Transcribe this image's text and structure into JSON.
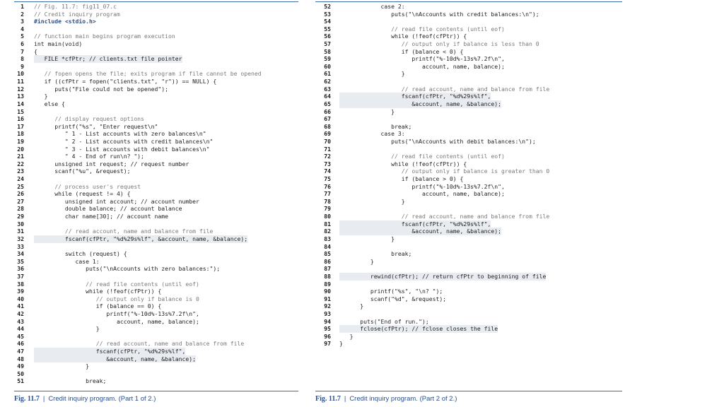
{
  "left": {
    "caption": {
      "fig": "Fig. 11.7",
      "sep": "|",
      "text": "Credit inquiry program. (Part 1 of 2.)"
    },
    "lines": [
      {
        "n": "1",
        "t": "// Fig. 11.7: fig11_07.c",
        "k": "cm"
      },
      {
        "n": "2",
        "t": "// Credit inquiry program",
        "k": "cm"
      },
      {
        "n": "3",
        "t": "#include <stdio.h>",
        "k": "kw"
      },
      {
        "n": "4",
        "t": "",
        "k": ""
      },
      {
        "n": "5",
        "t": "// function main begins program execution",
        "k": "cm"
      },
      {
        "n": "6",
        "t": "int main(void)",
        "k": ""
      },
      {
        "n": "7",
        "t": "{",
        "k": ""
      },
      {
        "n": "8",
        "t": "   FILE *cfPtr; // clients.txt file pointer",
        "k": "hl"
      },
      {
        "n": "9",
        "t": "",
        "k": ""
      },
      {
        "n": "10",
        "t": "   // fopen opens the file; exits program if file cannot be opened",
        "k": "cm"
      },
      {
        "n": "11",
        "t": "   if ((cfPtr = fopen(\"clients.txt\", \"r\")) == NULL) {",
        "k": ""
      },
      {
        "n": "12",
        "t": "      puts(\"File could not be opened\");",
        "k": ""
      },
      {
        "n": "13",
        "t": "   }",
        "k": ""
      },
      {
        "n": "14",
        "t": "   else {",
        "k": ""
      },
      {
        "n": "15",
        "t": "",
        "k": ""
      },
      {
        "n": "16",
        "t": "      // display request options",
        "k": "cm"
      },
      {
        "n": "17",
        "t": "      printf(\"%s\", \"Enter request\\n\"",
        "k": ""
      },
      {
        "n": "18",
        "t": "         \" 1 - List accounts with zero balances\\n\"",
        "k": ""
      },
      {
        "n": "19",
        "t": "         \" 2 - List accounts with credit balances\\n\"",
        "k": ""
      },
      {
        "n": "20",
        "t": "         \" 3 - List accounts with debit balances\\n\"",
        "k": ""
      },
      {
        "n": "21",
        "t": "         \" 4 - End of run\\n? \");",
        "k": ""
      },
      {
        "n": "22",
        "t": "      unsigned int request; // request number",
        "k": ""
      },
      {
        "n": "23",
        "t": "      scanf(\"%u\", &request);",
        "k": ""
      },
      {
        "n": "24",
        "t": "",
        "k": ""
      },
      {
        "n": "25",
        "t": "      // process user's request",
        "k": "cm"
      },
      {
        "n": "26",
        "t": "      while (request != 4) {",
        "k": ""
      },
      {
        "n": "27",
        "t": "         unsigned int account; // account number",
        "k": ""
      },
      {
        "n": "28",
        "t": "         double balance; // account balance",
        "k": ""
      },
      {
        "n": "29",
        "t": "         char name[30]; // account name",
        "k": ""
      },
      {
        "n": "30",
        "t": "",
        "k": ""
      },
      {
        "n": "31",
        "t": "         // read account, name and balance from file",
        "k": "cm"
      },
      {
        "n": "32",
        "t": "         fscanf(cfPtr, \"%d%29s%lf\", &account, name, &balance);",
        "k": "hl"
      },
      {
        "n": "33",
        "t": "",
        "k": ""
      },
      {
        "n": "34",
        "t": "         switch (request) {",
        "k": ""
      },
      {
        "n": "35",
        "t": "            case 1:",
        "k": ""
      },
      {
        "n": "36",
        "t": "               puts(\"\\nAccounts with zero balances:\");",
        "k": ""
      },
      {
        "n": "37",
        "t": "",
        "k": ""
      },
      {
        "n": "38",
        "t": "               // read file contents (until eof)",
        "k": "cm"
      },
      {
        "n": "39",
        "t": "               while (!feof(cfPtr)) {",
        "k": ""
      },
      {
        "n": "40",
        "t": "                  // output only if balance is 0",
        "k": "cm"
      },
      {
        "n": "41",
        "t": "                  if (balance == 0) {",
        "k": ""
      },
      {
        "n": "42",
        "t": "                     printf(\"%-10d%-13s%7.2f\\n\",",
        "k": ""
      },
      {
        "n": "43",
        "t": "                        account, name, balance);",
        "k": ""
      },
      {
        "n": "44",
        "t": "                  }",
        "k": ""
      },
      {
        "n": "45",
        "t": "",
        "k": ""
      },
      {
        "n": "46",
        "t": "                  // read account, name and balance from file",
        "k": "cm"
      },
      {
        "n": "47",
        "t": "                  fscanf(cfPtr, \"%d%29s%lf\",",
        "k": "hl"
      },
      {
        "n": "48",
        "t": "                     &account, name, &balance);",
        "k": "hl"
      },
      {
        "n": "49",
        "t": "               }",
        "k": ""
      },
      {
        "n": "50",
        "t": "",
        "k": ""
      },
      {
        "n": "51",
        "t": "               break;",
        "k": ""
      }
    ]
  },
  "right": {
    "caption": {
      "fig": "Fig. 11.7",
      "sep": "|",
      "text": "Credit inquiry program. (Part 2 of 2.)"
    },
    "lines": [
      {
        "n": "52",
        "t": "            case 2:",
        "k": ""
      },
      {
        "n": "53",
        "t": "               puts(\"\\nAccounts with credit balances:\\n\");",
        "k": ""
      },
      {
        "n": "54",
        "t": "",
        "k": ""
      },
      {
        "n": "55",
        "t": "               // read file contents (until eof)",
        "k": "cm"
      },
      {
        "n": "56",
        "t": "               while (!feof(cfPtr)) {",
        "k": ""
      },
      {
        "n": "57",
        "t": "                  // output only if balance is less than 0",
        "k": "cm"
      },
      {
        "n": "58",
        "t": "                  if (balance < 0) {",
        "k": ""
      },
      {
        "n": "59",
        "t": "                     printf(\"%-10d%-13s%7.2f\\n\",",
        "k": ""
      },
      {
        "n": "60",
        "t": "                        account, name, balance);",
        "k": ""
      },
      {
        "n": "61",
        "t": "                  }",
        "k": ""
      },
      {
        "n": "62",
        "t": "",
        "k": ""
      },
      {
        "n": "63",
        "t": "                  // read account, name and balance from file",
        "k": "cm"
      },
      {
        "n": "64",
        "t": "                  fscanf(cfPtr, \"%d%29s%lf\",",
        "k": "hl"
      },
      {
        "n": "65",
        "t": "                     &account, name, &balance);",
        "k": "hl"
      },
      {
        "n": "66",
        "t": "               }",
        "k": ""
      },
      {
        "n": "67",
        "t": "",
        "k": ""
      },
      {
        "n": "68",
        "t": "               break;",
        "k": ""
      },
      {
        "n": "69",
        "t": "            case 3:",
        "k": ""
      },
      {
        "n": "70",
        "t": "               puts(\"\\nAccounts with debit balances:\\n\");",
        "k": ""
      },
      {
        "n": "71",
        "t": "",
        "k": ""
      },
      {
        "n": "72",
        "t": "               // read file contents (until eof)",
        "k": "cm"
      },
      {
        "n": "73",
        "t": "               while (!feof(cfPtr)) {",
        "k": ""
      },
      {
        "n": "74",
        "t": "                  // output only if balance is greater than 0",
        "k": "cm"
      },
      {
        "n": "75",
        "t": "                  if (balance > 0) {",
        "k": ""
      },
      {
        "n": "76",
        "t": "                     printf(\"%-10d%-13s%7.2f\\n\",",
        "k": ""
      },
      {
        "n": "77",
        "t": "                        account, name, balance);",
        "k": ""
      },
      {
        "n": "78",
        "t": "                  }",
        "k": ""
      },
      {
        "n": "79",
        "t": "",
        "k": ""
      },
      {
        "n": "80",
        "t": "                  // read account, name and balance from file",
        "k": "cm"
      },
      {
        "n": "81",
        "t": "                  fscanf(cfPtr, \"%d%29s%lf\",",
        "k": "hl"
      },
      {
        "n": "82",
        "t": "                     &account, name, &balance);",
        "k": "hl"
      },
      {
        "n": "83",
        "t": "               }",
        "k": ""
      },
      {
        "n": "84",
        "t": "",
        "k": ""
      },
      {
        "n": "85",
        "t": "               break;",
        "k": ""
      },
      {
        "n": "86",
        "t": "         }",
        "k": ""
      },
      {
        "n": "87",
        "t": "",
        "k": ""
      },
      {
        "n": "88",
        "t": "         rewind(cfPtr); // return cfPtr to beginning of file",
        "k": "hl"
      },
      {
        "n": "89",
        "t": "",
        "k": ""
      },
      {
        "n": "90",
        "t": "         printf(\"%s\", \"\\n? \");",
        "k": ""
      },
      {
        "n": "91",
        "t": "         scanf(\"%d\", &request);",
        "k": ""
      },
      {
        "n": "92",
        "t": "      }",
        "k": ""
      },
      {
        "n": "93",
        "t": "",
        "k": ""
      },
      {
        "n": "94",
        "t": "      puts(\"End of run.\");",
        "k": ""
      },
      {
        "n": "95",
        "t": "      fclose(cfPtr); // fclose closes the file",
        "k": "hl"
      },
      {
        "n": "96",
        "t": "   }",
        "k": ""
      },
      {
        "n": "97",
        "t": "}",
        "k": ""
      }
    ]
  }
}
